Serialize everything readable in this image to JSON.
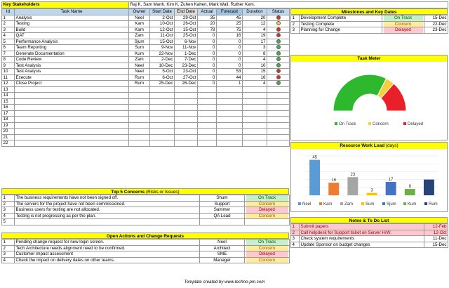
{
  "header": {
    "label": "Key Stakeholders",
    "value": "Raj K, Sam Manh, Kim K, Zuhen Kahen, Mark Wall, Ruther Kem."
  },
  "tasks": {
    "columns": [
      "Id",
      "Task Name",
      "Owner",
      "Start Date",
      "End Date",
      "Actual",
      "Forecast",
      "Duration",
      "Status"
    ],
    "rows": [
      {
        "id": "1",
        "name": "Analysis",
        "owner": "Neel",
        "start": "2-Oct",
        "end": "29-Oct",
        "actual": "35",
        "forecast": "45",
        "duration": "20",
        "status": "delayed"
      },
      {
        "id": "2",
        "name": "Testing",
        "owner": "Kam",
        "start": "10-Oct",
        "end": "26-Oct",
        "actual": "20",
        "forecast": "25",
        "duration": "12",
        "status": "concern"
      },
      {
        "id": "3",
        "name": "Build",
        "owner": "Kam",
        "start": "12-Oct",
        "end": "15-Oct",
        "actual": "78",
        "forecast": "75",
        "duration": "4",
        "status": "delayed"
      },
      {
        "id": "4",
        "name": "QAT",
        "owner": "Zam",
        "start": "11-Oct",
        "end": "25-Oct",
        "actual": "0",
        "forecast": "16",
        "duration": "19",
        "status": "delayed"
      },
      {
        "id": "5",
        "name": "Performance Analysis",
        "owner": "Sjum",
        "start": "15-Oct",
        "end": "6-Nov",
        "actual": "0",
        "forecast": "0",
        "duration": "17",
        "status": "ontrack"
      },
      {
        "id": "6",
        "name": "Team Reporting",
        "owner": "Sum",
        "start": "9-Nov",
        "end": "11-Nov",
        "actual": "0",
        "forecast": "0",
        "duration": "3",
        "status": "ontrack"
      },
      {
        "id": "7",
        "name": "Generate Documentation",
        "owner": "Kum",
        "start": "22-Nov",
        "end": "1-Dec",
        "actual": "0",
        "forecast": "0",
        "duration": "8",
        "status": "ontrack"
      },
      {
        "id": "8",
        "name": "Code Review",
        "owner": "Zam",
        "start": "2-Dec",
        "end": "7-Dec",
        "actual": "0",
        "forecast": "0",
        "duration": "4",
        "status": "ontrack"
      },
      {
        "id": "9",
        "name": "Test Analysis",
        "owner": "Neel",
        "start": "10-Dec",
        "end": "23-Dec",
        "actual": "0",
        "forecast": "0",
        "duration": "10",
        "status": "ontrack"
      },
      {
        "id": "10",
        "name": "Test Analysis",
        "owner": "Neel",
        "start": "5-Oct",
        "end": "23-Oct",
        "actual": "0",
        "forecast": "53",
        "duration": "15",
        "status": "delayed"
      },
      {
        "id": "11",
        "name": "Execute",
        "owner": "Rum",
        "start": "6-Oct",
        "end": "27-Oct",
        "actual": "0",
        "forecast": "44",
        "duration": "16",
        "status": "delayed"
      },
      {
        "id": "12",
        "name": "Close Project",
        "owner": "Rum",
        "start": "25-Dec",
        "end": "26-Dec",
        "actual": "0",
        "forecast": "1",
        "duration": "4",
        "status": "ontrack"
      }
    ],
    "empty_ids": [
      "13",
      "14",
      "15",
      "16",
      "17",
      "18",
      "19",
      "20",
      "21",
      "22"
    ]
  },
  "status_colors": {
    "ontrack": "#4caf50",
    "concern": "#f4d03f",
    "delayed": "#d9312b"
  },
  "milestones": {
    "title": "Milestones and Key Dates",
    "rows": [
      {
        "id": "1",
        "name": "Development Complete",
        "status": "On Track",
        "status_key": "ontrack",
        "date": "15-Dec"
      },
      {
        "id": "2",
        "name": "Testing Complete",
        "status": "Concern",
        "status_key": "concern",
        "date": "22-Dec"
      },
      {
        "id": "3",
        "name": "Planning for Change",
        "status": "Delayed",
        "status_key": "delayed",
        "date": "23-Dec"
      }
    ]
  },
  "task_meter": {
    "title": "Task Meter",
    "legend": [
      "On Track",
      "Concern",
      "Delayed"
    ]
  },
  "workload": {
    "title": "Resource Work Load",
    "title_suffix": "(days)"
  },
  "chart_data": [
    {
      "type": "pie",
      "title": "Task Meter",
      "variant": "half-donut",
      "categories": [
        "On Track",
        "Concern",
        "Delayed"
      ],
      "values": [
        65,
        8,
        27
      ],
      "colors": [
        "#2eb82e",
        "#f4d03f",
        "#e8202a"
      ],
      "legend": "bottom"
    },
    {
      "type": "bar",
      "title": "Resource Work Load",
      "categories": [
        "Neel",
        "Kam",
        "Zam",
        "Sum",
        "Sjum",
        "Kum",
        "Rum"
      ],
      "values": [
        45,
        16,
        23,
        3,
        17,
        8,
        20
      ],
      "labels": [
        "45",
        "16",
        "23",
        "3",
        "17",
        "8",
        ""
      ],
      "colors": [
        "#5b9bd5",
        "#ed7d31",
        "#a5a5a5",
        "#ffc000",
        "#4472c4",
        "#70ad47",
        "#264478"
      ],
      "ylim": [
        0,
        50
      ],
      "grid": true,
      "legend": "bottom"
    }
  ],
  "concerns": {
    "title": "Top 5 Concerns",
    "title_suffix": "(Risks or Issues)",
    "rows": [
      {
        "id": "1",
        "text": "The business requirements have not been signed off.",
        "owner": "Shum",
        "status": "On Track",
        "status_key": "ontrack"
      },
      {
        "id": "2",
        "text": "The servers for the project have not been commissioned.",
        "owner": "Support",
        "status": "Concern",
        "status_key": "concern"
      },
      {
        "id": "3",
        "text": "Business users for testing are not allocated.",
        "owner": "Sammer",
        "status": "Delayed",
        "status_key": "delayed"
      },
      {
        "id": "4",
        "text": "Testing is not progressing as per the plan.",
        "owner": "QA Lead",
        "status": "Concern",
        "status_key": "concern"
      },
      {
        "id": "5",
        "text": "",
        "owner": "",
        "status": "",
        "status_key": ""
      }
    ]
  },
  "actions": {
    "title": "Open Actions and Change Requests",
    "rows": [
      {
        "id": "1",
        "text": "Pending change request for new login screen.",
        "owner": "Neel",
        "status": "On Track",
        "status_key": "ontrack"
      },
      {
        "id": "2",
        "text": "Tech Architecture needs alignment need to be confirmed.",
        "owner": "Architect",
        "status": "Concern",
        "status_key": "concern"
      },
      {
        "id": "3",
        "text": "Customer impact assessment",
        "owner": "SME",
        "status": "Delayed",
        "status_key": "delayed"
      },
      {
        "id": "4",
        "text": "Check the impact on delivery dates on other teams.",
        "owner": "Manager",
        "status": "Concern",
        "status_key": "concern"
      }
    ]
  },
  "notes": {
    "title": "Notes & To Do List",
    "rows": [
      {
        "id": "1",
        "text": "Submit papers",
        "date": "12-Feb",
        "highlight": true
      },
      {
        "id": "2",
        "text": "Call helpdesk for Support ticket on Server H/W.",
        "date": "12-Oct",
        "highlight": true
      },
      {
        "id": "3",
        "text": "Check system requirements",
        "date": "11-Dec",
        "highlight": false
      },
      {
        "id": "4",
        "text": "Update Sponsor on budget changes",
        "date": "15-Dec",
        "highlight": false
      }
    ]
  },
  "footer": "Template created by www.techno-pm.com"
}
